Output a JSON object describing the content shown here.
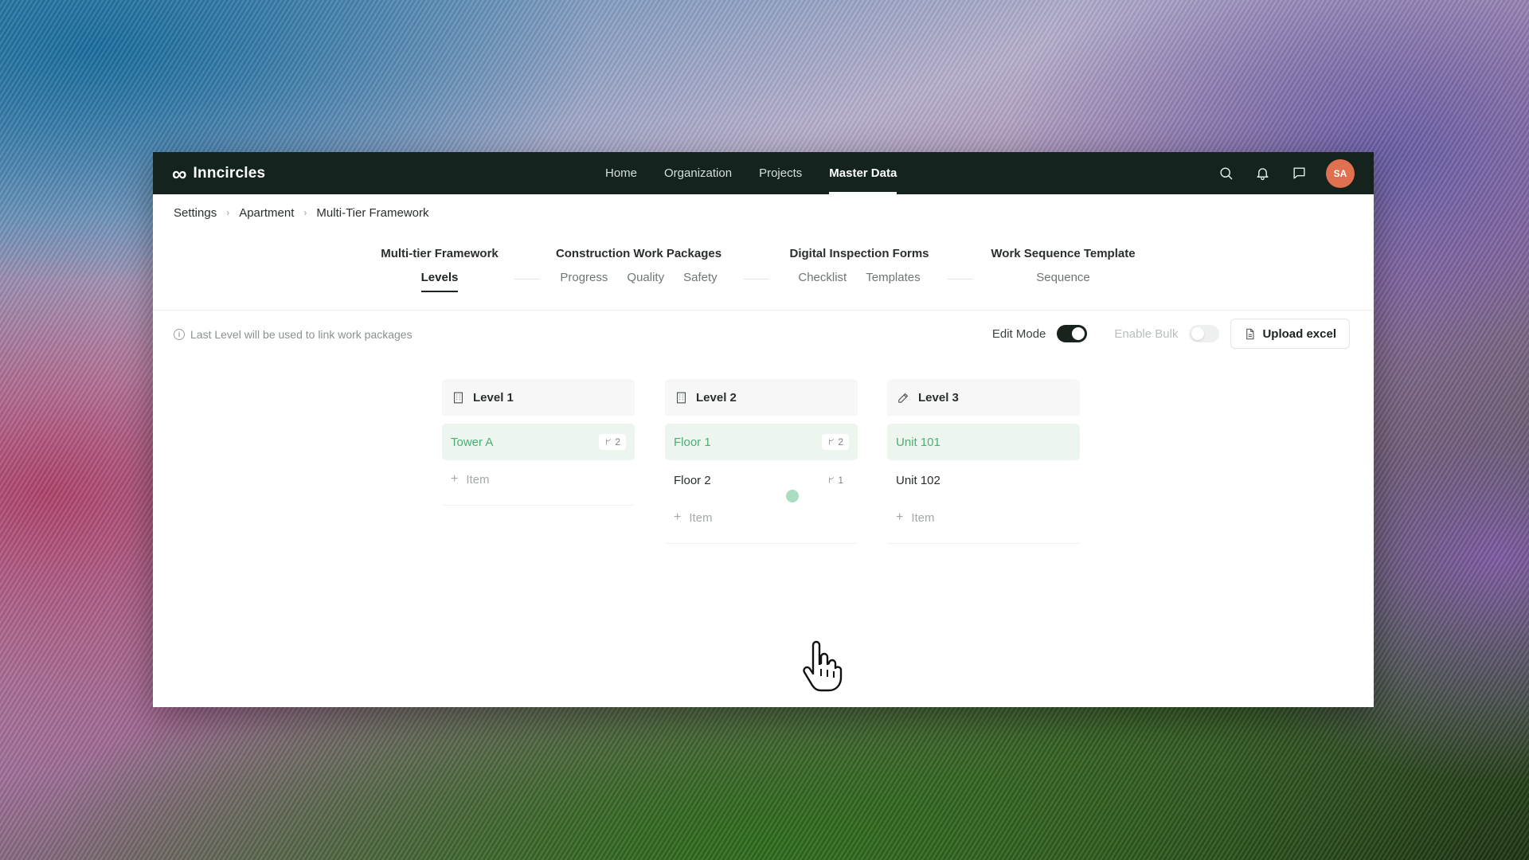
{
  "app": {
    "logo_glyph": "∞",
    "brand_name": "Inncircles",
    "accent_color": "#4cae73",
    "nav_bg_color": "#14231d",
    "avatar_color": "#e0704f"
  },
  "nav": {
    "links": [
      {
        "label": "Home",
        "active": false
      },
      {
        "label": "Organization",
        "active": false
      },
      {
        "label": "Projects",
        "active": false
      },
      {
        "label": "Master Data",
        "active": true
      }
    ],
    "icons": [
      "search-icon",
      "bell-icon",
      "chat-icon"
    ],
    "avatar_initials": "SA"
  },
  "breadcrumb": [
    "Settings",
    "Apartment",
    "Multi-Tier Framework"
  ],
  "module_tabs": [
    {
      "title": "Multi-tier Framework",
      "tabs": [
        {
          "label": "Levels",
          "active": true
        }
      ]
    },
    {
      "title": "Construction Work Packages",
      "tabs": [
        {
          "label": "Progress"
        },
        {
          "label": "Quality"
        },
        {
          "label": "Safety"
        }
      ]
    },
    {
      "title": "Digital Inspection Forms",
      "tabs": [
        {
          "label": "Checklist"
        },
        {
          "label": "Templates"
        }
      ]
    },
    {
      "title": "Work Sequence Template",
      "tabs": [
        {
          "label": "Sequence"
        }
      ]
    }
  ],
  "toolbar": {
    "info_text": "Last Level will be used to link work packages",
    "edit_mode_label": "Edit Mode",
    "edit_mode_on": true,
    "enable_bulk_label": "Enable Bulk",
    "enable_bulk_on": false,
    "upload_label": "Upload excel"
  },
  "levels": [
    {
      "title": "Level 1",
      "icon": "building-icon",
      "items": [
        {
          "label": "Tower A",
          "count": "2",
          "selected": true
        }
      ],
      "add_label": "Item"
    },
    {
      "title": "Level 2",
      "icon": "building-icon",
      "items": [
        {
          "label": "Floor 1",
          "count": "2",
          "selected": true
        },
        {
          "label": "Floor 2",
          "count": "1",
          "selected": false
        }
      ],
      "add_label": "Item"
    },
    {
      "title": "Level 3",
      "icon": "pencil-icon",
      "items": [
        {
          "label": "Unit 101",
          "selected": true
        },
        {
          "label": "Unit 102",
          "selected": false
        }
      ],
      "add_label": "Item"
    }
  ]
}
